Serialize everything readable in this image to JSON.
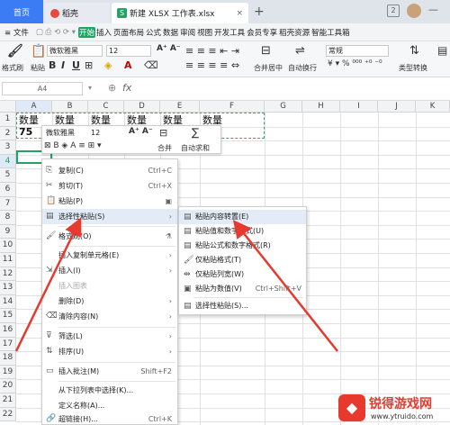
{
  "tabs": {
    "home": "首页",
    "daoke": "稻壳",
    "file": "新建 XLSX 工作表.xlsx",
    "close": "×",
    "plus": "+",
    "badge": "2"
  },
  "menubar": {
    "file": "≡ 文件",
    "items": [
      "开始",
      "插入",
      "页面布局",
      "公式",
      "数据",
      "审阅",
      "视图",
      "开发工具",
      "会员专享",
      "稻壳资源",
      "智能工具箱"
    ]
  },
  "ribbon": {
    "format_painter": "格式刷",
    "paste": "粘贴",
    "font": "微软雅黑",
    "size": "12",
    "merge": "合并居中",
    "wrap": "自动换行",
    "numfmt": "常规",
    "convert": "类型转换"
  },
  "formula": {
    "namebox": "A4",
    "fx": "fx"
  },
  "columns": [
    "A",
    "B",
    "C",
    "D",
    "E",
    "F",
    "G",
    "H",
    "I",
    "J",
    "K"
  ],
  "rows": [
    "1",
    "2",
    "3",
    "4",
    "5",
    "6",
    "7",
    "8",
    "9",
    "10",
    "11",
    "12",
    "13",
    "14",
    "15",
    "16",
    "17",
    "18",
    "19",
    "20",
    "21",
    "22"
  ],
  "cells": {
    "a1": "数量",
    "b1": "数量",
    "c1": "数量",
    "d1": "数量",
    "e1": "数量",
    "f1": "数量",
    "a2": "75"
  },
  "mini_toolbar": {
    "font": "微软雅黑",
    "size": "12",
    "merge": "合并",
    "autosum": "自动求和"
  },
  "context_menu": {
    "copy": "复制(C)",
    "copy_sc": "Ctrl+C",
    "cut": "剪切(T)",
    "cut_sc": "Ctrl+X",
    "paste": "粘贴(P)",
    "paste_special": "选择性粘贴(S)",
    "format_painter": "格式刷(O)",
    "insert_copied": "插入复制单元格(E)",
    "insert": "插入(I)",
    "insert_chart": "插入图表",
    "delete": "删除(D)",
    "clear": "清除内容(N)",
    "filter": "筛选(L)",
    "sort": "排序(U)",
    "insert_comment": "插入批注(M)",
    "comment_sc": "Shift+F2",
    "dropdown": "从下拉列表中选择(K)...",
    "define_name": "定义名称(A)...",
    "hyperlink": "超链接(H)...",
    "hyperlink_sc": "Ctrl+K"
  },
  "submenu": {
    "transpose": "粘贴内容转置(E)",
    "values_numfmt": "粘贴值和数字格式(U)",
    "formula_numfmt": "粘贴公式和数字格式(R)",
    "format_only": "仅粘贴格式(T)",
    "colwidth_only": "仅粘贴列宽(W)",
    "as_values": "粘贴为数值(V)",
    "as_values_sc": "Ctrl+Shift+V",
    "paste_special": "选择性粘贴(S)..."
  },
  "watermark": {
    "title": "锐得游戏网",
    "url": "www.ytruido.com"
  },
  "colors": {
    "accent": "#3b7cf4",
    "wps_green": "#1fa463",
    "arrow_red": "#e8392f"
  }
}
